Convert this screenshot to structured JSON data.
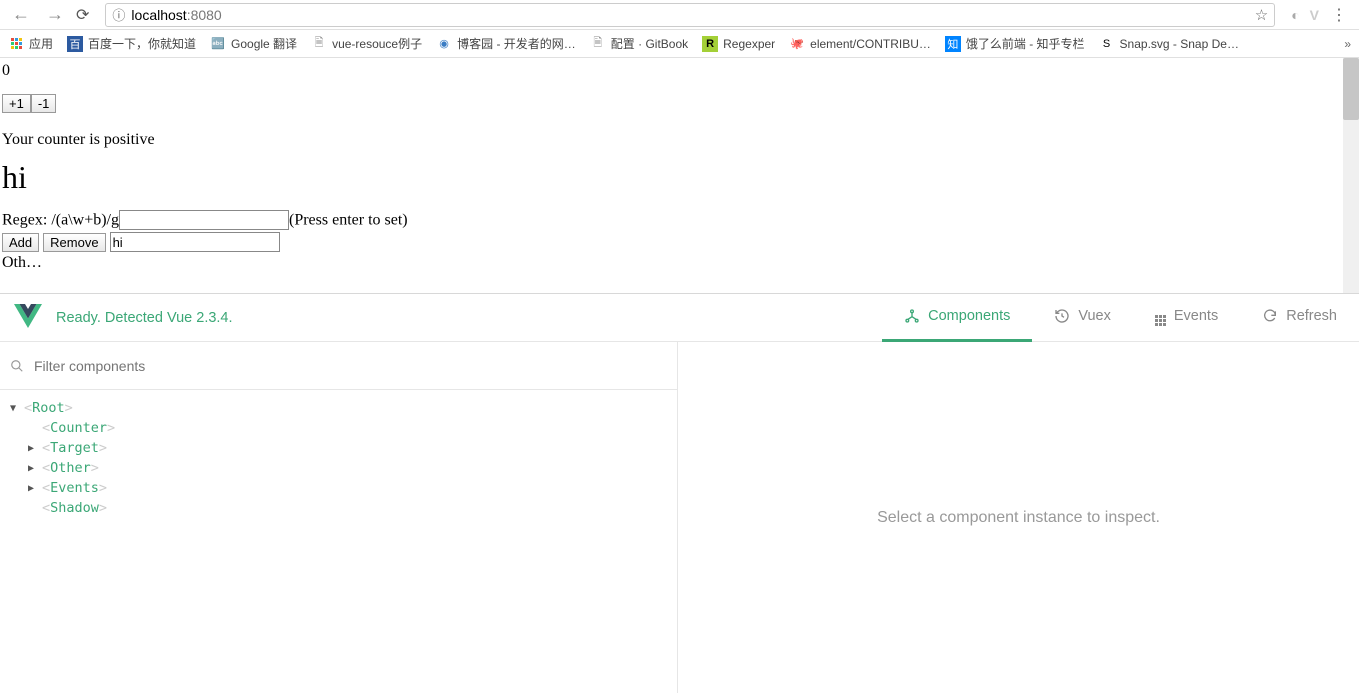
{
  "browser": {
    "url_host": "localhost",
    "url_port": ":8080"
  },
  "bookmarks": {
    "apps": "应用",
    "items": [
      "百度一下，你就知道",
      "Google 翻译",
      "vue-resouce例子",
      "博客园 - 开发者的网…",
      "配置 · GitBook",
      "Regexper",
      "element/CONTRIBU…",
      "饿了么前端 - 知乎专栏",
      "Snap.svg - Snap De…"
    ]
  },
  "page": {
    "counter_value": "0",
    "btn_inc": "+1",
    "btn_dec": "-1",
    "counter_msg": "Your counter is positive",
    "heading": "hi",
    "regex_label": "Regex: /(a\\w+b)/g",
    "regex_hint": "(Press enter to set)",
    "btn_add": "Add",
    "btn_remove": "Remove",
    "input2_value": "hi",
    "other_partial": "Oth…"
  },
  "devtools": {
    "status": "Ready. Detected Vue 2.3.4.",
    "tabs": {
      "components": "Components",
      "vuex": "Vuex",
      "events": "Events",
      "refresh": "Refresh"
    },
    "filter_placeholder": "Filter components",
    "tree": [
      {
        "label": "Root",
        "level": 0,
        "arrow": "down"
      },
      {
        "label": "Counter",
        "level": 1,
        "arrow": ""
      },
      {
        "label": "Target",
        "level": 1,
        "arrow": "right"
      },
      {
        "label": "Other",
        "level": 1,
        "arrow": "right"
      },
      {
        "label": "Events",
        "level": 1,
        "arrow": "right"
      },
      {
        "label": "Shadow",
        "level": 1,
        "arrow": ""
      }
    ],
    "empty_msg": "Select a component instance to inspect."
  }
}
